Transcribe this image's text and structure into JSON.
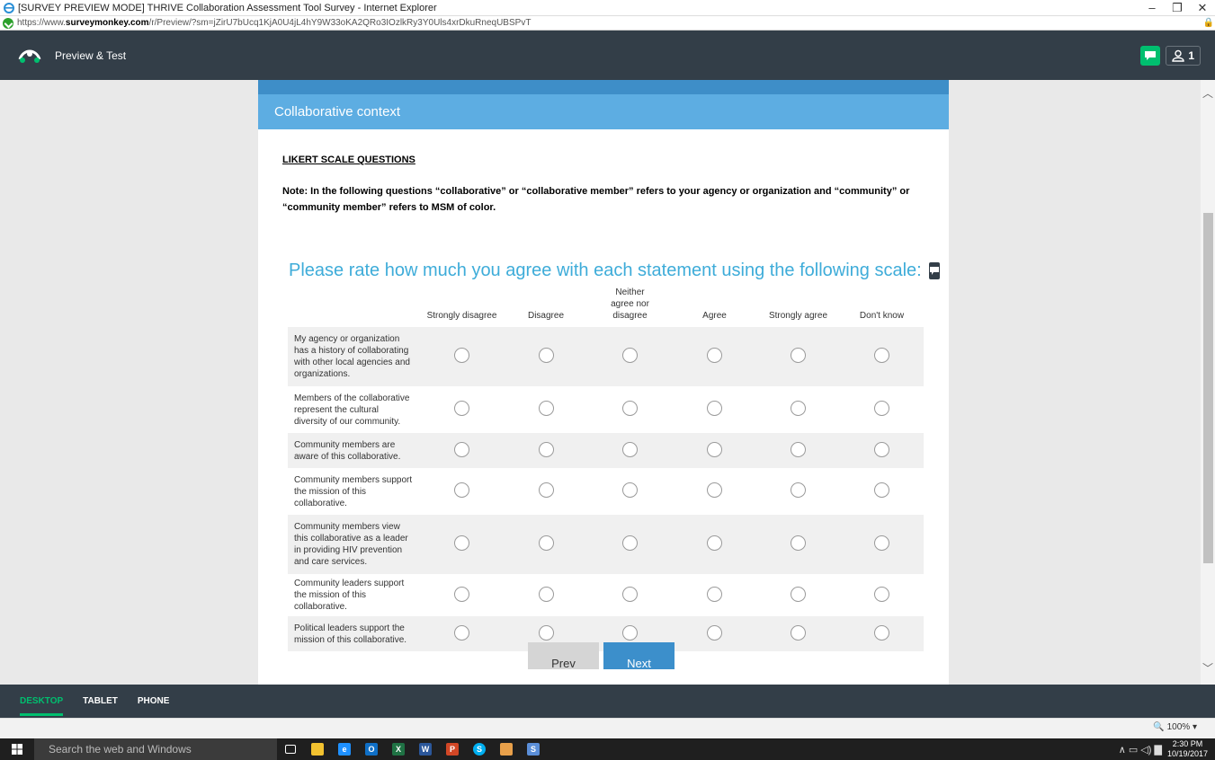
{
  "window": {
    "title": "[SURVEY PREVIEW MODE] THRIVE Collaboration Assessment Tool Survey - Internet Explorer",
    "url_prefix": "https://www.",
    "url_domain": "surveymonkey.com",
    "url_path": "/r/Preview/?sm=jZirU7bUcq1KjA0U4jL4hY9W33oKA2QRo3IOzlkRy3Y0Uls4xrDkuRneqUBSPvT",
    "minimize": "–",
    "restore": "❐",
    "close": "✕"
  },
  "header": {
    "preview_label": "Preview & Test",
    "user_count": "1"
  },
  "survey": {
    "page_title": "Collaborative context",
    "section_heading": "LIKERT SCALE QUESTIONS",
    "note": "Note: In the following questions “collaborative” or “collaborative member” refers to your agency or organization and “community” or “community member” refers to MSM of color.",
    "question": "Please rate how much you agree with each statement using the following scale:",
    "columns": [
      "Strongly disagree",
      "Disagree",
      "Neither agree nor disagree",
      "Agree",
      "Strongly agree",
      "Don't know"
    ],
    "rows": [
      "My agency or organization has a history of collaborating with other local agencies and organizations.",
      "Members of the collaborative represent the cultural diversity of our community.",
      "Community members are aware of this collaborative.",
      "Community members support the mission of this collaborative.",
      "Community members view this collaborative as a leader in providing HIV prevention and care services.",
      "Community leaders support the mission of this collaborative.",
      "Political leaders support the mission of this collaborative."
    ],
    "prev_label": "Prev",
    "next_label": "Next"
  },
  "device_bar": {
    "desktop": "DESKTOP",
    "tablet": "TABLET",
    "phone": "PHONE"
  },
  "status": {
    "zoom": "100%"
  },
  "taskbar": {
    "search_placeholder": "Search the web and Windows",
    "time": "2:30 PM",
    "date": "10/19/2017"
  },
  "colors": {
    "accent_green": "#00bf6f",
    "header_dark": "#333e48",
    "page_title_blue": "#5dade2",
    "question_blue": "#3eacd9",
    "next_blue": "#3c8fcb"
  }
}
